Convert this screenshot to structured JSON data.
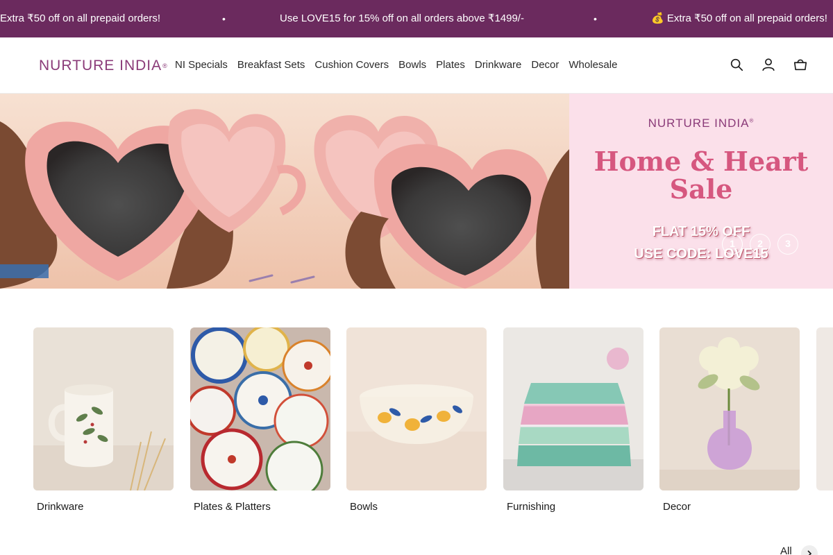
{
  "announcement": {
    "messages": [
      "Extra ₹50 off on all prepaid orders!",
      "Use LOVE15 for 15% off on all orders above ₹1499/-",
      "💰 Extra ₹50 off on all prepaid orders!"
    ],
    "separator": "•"
  },
  "header": {
    "logo": "NURTURE INDIA",
    "logo_mark": "®",
    "nav": [
      "NI Specials",
      "Breakfast Sets",
      "Cushion Covers",
      "Bowls",
      "Plates",
      "Drinkware",
      "Decor",
      "Wholesale"
    ],
    "icons": [
      "search-icon",
      "account-icon",
      "cart-icon"
    ]
  },
  "hero": {
    "brand": "NURTURE INDIA",
    "title_line1": "Home & Heart",
    "title_line2": "Sale",
    "offer_line1": "FLAT 15% OFF",
    "offer_line2": "USE CODE: LOVE15",
    "slides": [
      "1",
      "2",
      "3"
    ],
    "active_slide": 1,
    "colors": {
      "panel": "#fbe0ea",
      "title": "#d6577f",
      "brand": "#8a3a78"
    }
  },
  "categories": [
    {
      "label": "Drinkware"
    },
    {
      "label": "Plates & Platters"
    },
    {
      "label": "Bowls"
    },
    {
      "label": "Furnishing"
    },
    {
      "label": "Decor"
    }
  ],
  "footer_controls": {
    "view_all": "All"
  },
  "colors": {
    "announcement_bg": "#6b2a5e",
    "brand": "#8a3a78"
  }
}
